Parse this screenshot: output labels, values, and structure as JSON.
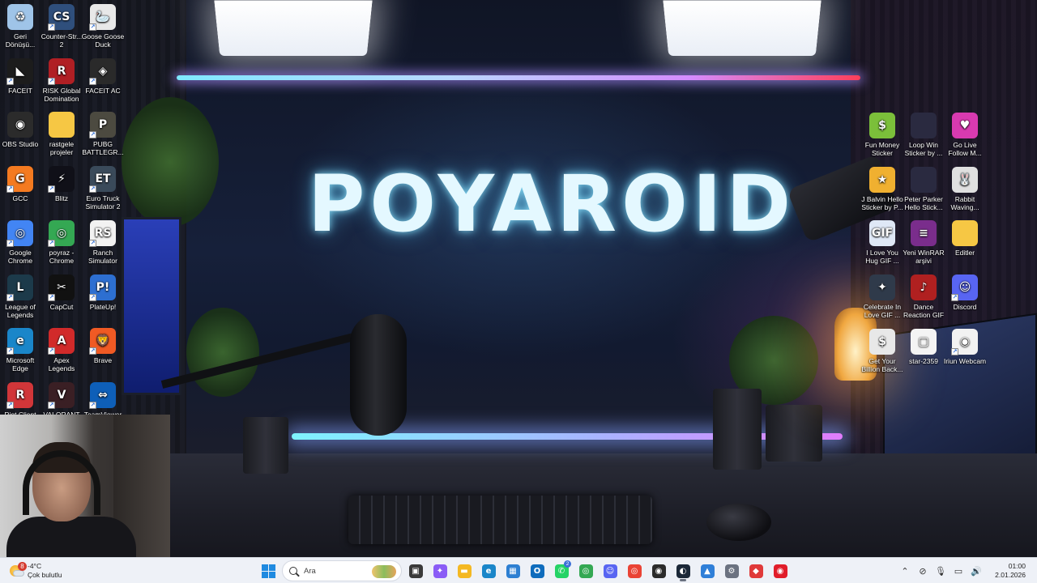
{
  "wallpaper": {
    "brand_text": "POYAROID"
  },
  "desktop_left": [
    {
      "label": "Geri Dönüşü...",
      "icon": "recycle-bin-icon",
      "color": "#9fc4e8",
      "glyph": "♻",
      "shortcut": false
    },
    {
      "label": "Counter-Str... 2",
      "icon": "counter-strike-icon",
      "color": "#2f4f7c",
      "glyph": "CS",
      "shortcut": true
    },
    {
      "label": "Goose Goose Duck",
      "icon": "goose-goose-duck-icon",
      "color": "#e8e8e8",
      "glyph": "🦢",
      "shortcut": true
    },
    {
      "label": "FACEIT",
      "icon": "faceit-icon",
      "color": "#1c1c1c",
      "glyph": "◣",
      "shortcut": true
    },
    {
      "label": "RISK Global Domination",
      "icon": "risk-icon",
      "color": "#b01f24",
      "glyph": "R",
      "shortcut": true
    },
    {
      "label": "FACEIT AC",
      "icon": "faceit-ac-icon",
      "color": "#2a2a2a",
      "glyph": "◈",
      "shortcut": true
    },
    {
      "label": "OBS Studio",
      "icon": "obs-studio-icon",
      "color": "#2b2b2b",
      "glyph": "◉",
      "shortcut": false
    },
    {
      "label": "rastgele projeler",
      "icon": "folder-icon",
      "color": "#f6c744",
      "glyph": "",
      "shortcut": false
    },
    {
      "label": "PUBG BATTLEGR...",
      "icon": "pubg-icon",
      "color": "#4c4a40",
      "glyph": "P",
      "shortcut": true
    },
    {
      "label": "GCC",
      "icon": "gcc-icon",
      "color": "#f47a20",
      "glyph": "G",
      "shortcut": true
    },
    {
      "label": "Blitz",
      "icon": "blitz-icon",
      "color": "#101018",
      "glyph": "⚡",
      "shortcut": true
    },
    {
      "label": "Euro Truck Simulator 2",
      "icon": "euro-truck-icon",
      "color": "#3a4a5a",
      "glyph": "ET",
      "shortcut": true
    },
    {
      "label": "Google Chrome",
      "icon": "chrome-icon",
      "color": "#4285f4",
      "glyph": "◎",
      "shortcut": true
    },
    {
      "label": "poyraz - Chrome",
      "icon": "chrome-profile-icon",
      "color": "#34a853",
      "glyph": "◎",
      "shortcut": true
    },
    {
      "label": "Ranch Simulator",
      "icon": "ranch-simulator-icon",
      "color": "#f2f2f2",
      "glyph": "RS",
      "shortcut": true
    },
    {
      "label": "League of Legends",
      "icon": "league-of-legends-icon",
      "color": "#1c3a4a",
      "glyph": "L",
      "shortcut": true
    },
    {
      "label": "CapCut",
      "icon": "capcut-icon",
      "color": "#111111",
      "glyph": "✂",
      "shortcut": true
    },
    {
      "label": "PlateUp!",
      "icon": "plateup-icon",
      "color": "#2d6fd1",
      "glyph": "P!",
      "shortcut": true
    },
    {
      "label": "Microsoft Edge",
      "icon": "edge-icon",
      "color": "#1a86c9",
      "glyph": "e",
      "shortcut": true
    },
    {
      "label": "Apex Legends",
      "icon": "apex-legends-icon",
      "color": "#d12a2a",
      "glyph": "A",
      "shortcut": true
    },
    {
      "label": "Brave",
      "icon": "brave-icon",
      "color": "#f05a24",
      "glyph": "🦁",
      "shortcut": true
    },
    {
      "label": "Riot Client",
      "icon": "riot-client-icon",
      "color": "#d13639",
      "glyph": "R",
      "shortcut": true
    },
    {
      "label": "VALORANT",
      "icon": "valorant-icon",
      "color": "#3a1f24",
      "glyph": "V",
      "shortcut": true
    },
    {
      "label": "TeamViewer",
      "icon": "teamviewer-icon",
      "color": "#0e5fb8",
      "glyph": "⇔",
      "shortcut": true
    }
  ],
  "desktop_right": [
    {
      "label": "Fun Money Sticker",
      "icon": "sticker-icon",
      "color": "#7bbf3a",
      "glyph": "$",
      "shortcut": false
    },
    {
      "label": "Loop Win Sticker by ...",
      "icon": "sticker-icon",
      "color": "#2a2a40",
      "glyph": "",
      "shortcut": false
    },
    {
      "label": "Go Live Follow M...",
      "icon": "sticker-icon",
      "color": "#d83ab0",
      "glyph": "♥",
      "shortcut": false
    },
    {
      "label": "J Balvin Hello Sticker by P...",
      "icon": "sticker-icon",
      "color": "#f0b030",
      "glyph": "★",
      "shortcut": false
    },
    {
      "label": "Peter Parker Hello Stick...",
      "icon": "sticker-icon",
      "color": "#2a2a40",
      "glyph": "",
      "shortcut": false
    },
    {
      "label": "Rabbit Waving...",
      "icon": "sticker-icon",
      "color": "#e0e0e0",
      "glyph": "🐰",
      "shortcut": false
    },
    {
      "label": "I Love You Hug GIF ...",
      "icon": "gif-file-icon",
      "color": "#dfe8f6",
      "glyph": "GIF",
      "shortcut": false
    },
    {
      "label": "Yeni WinRAR arşivi",
      "icon": "winrar-icon",
      "color": "#7a2d8c",
      "glyph": "≡",
      "shortcut": false
    },
    {
      "label": "Editler",
      "icon": "folder-icon",
      "color": "#f6c744",
      "glyph": "",
      "shortcut": false
    },
    {
      "label": "Celebrate In Love GIF ...",
      "icon": "gif-file-icon",
      "color": "#2f3a4a",
      "glyph": "✦",
      "shortcut": false
    },
    {
      "label": "Dance Reaction GIF",
      "icon": "gif-file-icon",
      "color": "#b02020",
      "glyph": "♪",
      "shortcut": false
    },
    {
      "label": "Discord",
      "icon": "discord-icon",
      "color": "#5865f2",
      "glyph": "☺",
      "shortcut": true
    },
    {
      "label": "Get Your Billion Back...",
      "icon": "gif-file-icon",
      "color": "#e8e8e8",
      "glyph": "$",
      "shortcut": false
    },
    {
      "label": "star-2359",
      "icon": "file-icon",
      "color": "#f4f4f4",
      "glyph": "▢",
      "shortcut": false
    },
    {
      "label": "Iriun Webcam",
      "icon": "iriun-webcam-icon",
      "color": "#f2f2f2",
      "glyph": "◉",
      "shortcut": true
    }
  ],
  "taskbar": {
    "weather": {
      "temp": "-4°C",
      "condition": "Çok bulutlu",
      "badge": "8"
    },
    "search_placeholder": "Ara",
    "apps": [
      {
        "name": "taskbar-file-explorer-button",
        "icon": "task-view-icon",
        "color": "#3a3a3a",
        "glyph": "▣",
        "active": false,
        "badge": ""
      },
      {
        "name": "taskbar-copilot-button",
        "icon": "copilot-icon",
        "color": "#8a5cf6",
        "glyph": "✦",
        "active": false,
        "badge": ""
      },
      {
        "name": "taskbar-folder-button",
        "icon": "folder-icon",
        "color": "#f4b822",
        "glyph": "▬",
        "active": false,
        "badge": ""
      },
      {
        "name": "taskbar-edge-button",
        "icon": "edge-icon",
        "color": "#1a86c9",
        "glyph": "e",
        "active": false,
        "badge": ""
      },
      {
        "name": "taskbar-store-button",
        "icon": "store-icon",
        "color": "#2d7fd2",
        "glyph": "▦",
        "active": false,
        "badge": ""
      },
      {
        "name": "taskbar-outlook-button",
        "icon": "outlook-icon",
        "color": "#0f6cbd",
        "glyph": "O",
        "active": false,
        "badge": ""
      },
      {
        "name": "taskbar-whatsapp-button",
        "icon": "whatsapp-icon",
        "color": "#25d366",
        "glyph": "✆",
        "active": false,
        "badge": "2"
      },
      {
        "name": "taskbar-chrome-button",
        "icon": "chrome-icon",
        "color": "#34a853",
        "glyph": "◎",
        "active": false,
        "badge": ""
      },
      {
        "name": "taskbar-discord-button",
        "icon": "discord-icon",
        "color": "#5865f2",
        "glyph": "☺",
        "active": false,
        "badge": ""
      },
      {
        "name": "taskbar-chrome-profile-button",
        "icon": "chrome-icon",
        "color": "#ea4335",
        "glyph": "◎",
        "active": false,
        "badge": ""
      },
      {
        "name": "taskbar-obs-button",
        "icon": "obs-studio-icon",
        "color": "#2b2b2b",
        "glyph": "◉",
        "active": false,
        "badge": ""
      },
      {
        "name": "taskbar-steam-button",
        "icon": "steam-icon",
        "color": "#1b2838",
        "glyph": "◐",
        "active": true,
        "badge": ""
      },
      {
        "name": "taskbar-photos-button",
        "icon": "photos-icon",
        "color": "#2f7fd8",
        "glyph": "▲",
        "active": false,
        "badge": ""
      },
      {
        "name": "taskbar-settings-button",
        "icon": "gear-icon",
        "color": "#6b7280",
        "glyph": "⚙",
        "active": false,
        "badge": ""
      },
      {
        "name": "taskbar-capture-button",
        "icon": "recorder-icon",
        "color": "#e03a3a",
        "glyph": "◆",
        "active": false,
        "badge": ""
      },
      {
        "name": "taskbar-game-button",
        "icon": "gamepad-icon",
        "color": "#e11d2a",
        "glyph": "◉",
        "active": false,
        "badge": ""
      }
    ],
    "tray": [
      {
        "name": "tray-chevron-button",
        "icon": "chevron-up-icon",
        "glyph": "⌃"
      },
      {
        "name": "tray-network-off-button",
        "icon": "network-off-icon",
        "glyph": "⊘"
      },
      {
        "name": "tray-mic-button",
        "icon": "microphone-icon",
        "glyph": "🎙"
      },
      {
        "name": "tray-display-button",
        "icon": "monitor-icon",
        "glyph": "▭"
      },
      {
        "name": "tray-volume-button",
        "icon": "speaker-icon",
        "glyph": "🔊"
      }
    ],
    "clock": {
      "time": "01:00",
      "date": "2.01.2026"
    }
  }
}
